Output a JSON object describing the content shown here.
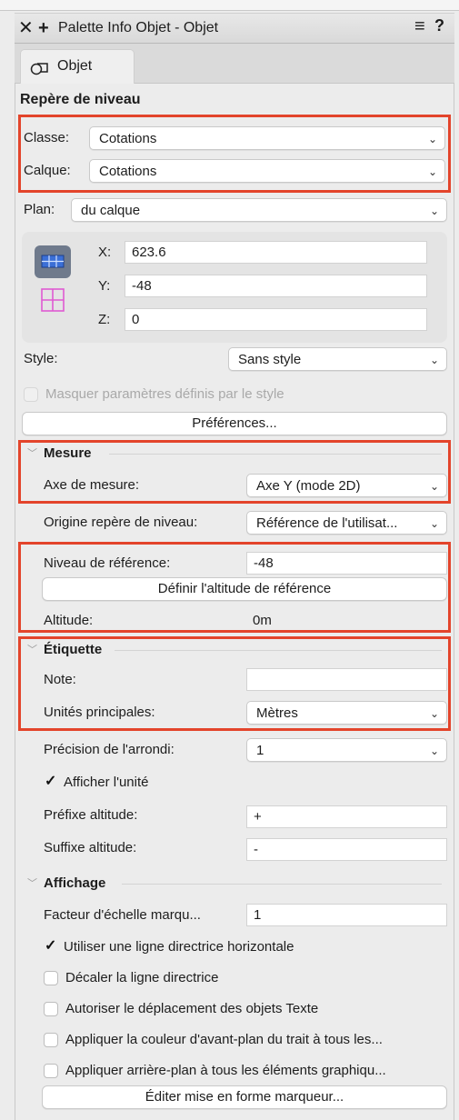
{
  "window": {
    "title": "Palette Info Objet - Objet"
  },
  "tab": {
    "label": "Objet"
  },
  "object_type": "Repère de niveau",
  "classe": {
    "label": "Classe:",
    "value": "Cotations"
  },
  "calque": {
    "label": "Calque:",
    "value": "Cotations"
  },
  "plan": {
    "label": "Plan:",
    "value": "du calque"
  },
  "coords": {
    "x_label": "X:",
    "x_value": "623.6",
    "y_label": "Y:",
    "y_value": "-48",
    "z_label": "Z:",
    "z_value": "0"
  },
  "style": {
    "label": "Style:",
    "value": "Sans style"
  },
  "masquer": {
    "label": "Masquer paramètres définis par le style"
  },
  "preferences_button": "Préférences...",
  "mesure": {
    "title": "Mesure",
    "axe_label": "Axe de mesure:",
    "axe_value": "Axe Y (mode 2D)",
    "origine_label": "Origine repère de niveau:",
    "origine_value": "Référence de l'utilisat...",
    "niveau_label": "Niveau de référence:",
    "niveau_value": "-48",
    "definir_button": "Définir l'altitude de référence",
    "altitude_label": "Altitude:",
    "altitude_value": "0m"
  },
  "etiquette": {
    "title": "Étiquette",
    "note_label": "Note:",
    "note_value": "",
    "unites_label": "Unités principales:",
    "unites_value": "Mètres",
    "precision_label": "Précision de l'arrondi:",
    "precision_value": "1",
    "afficher_unite": "Afficher l'unité",
    "prefixe_label": "Préfixe altitude:",
    "prefixe_value": "+",
    "suffixe_label": "Suffixe altitude:",
    "suffixe_value": "-"
  },
  "affichage": {
    "title": "Affichage",
    "facteur_label": "Facteur d'échelle marqu...",
    "facteur_value": "1",
    "opt1": "Utiliser une ligne directrice horizontale",
    "opt2": "Décaler la ligne directrice",
    "opt3": "Autoriser le déplacement des objets Texte",
    "opt4": "Appliquer la couleur d'avant-plan du trait à tous les...",
    "opt5": "Appliquer arrière-plan à tous les éléments graphiqu...",
    "editer_button": "Éditer mise en forme marqueur..."
  },
  "colors": {
    "highlight": "#e3442b",
    "icon_blue": "#3b6fd6",
    "icon_magenta": "#e05ad2"
  }
}
